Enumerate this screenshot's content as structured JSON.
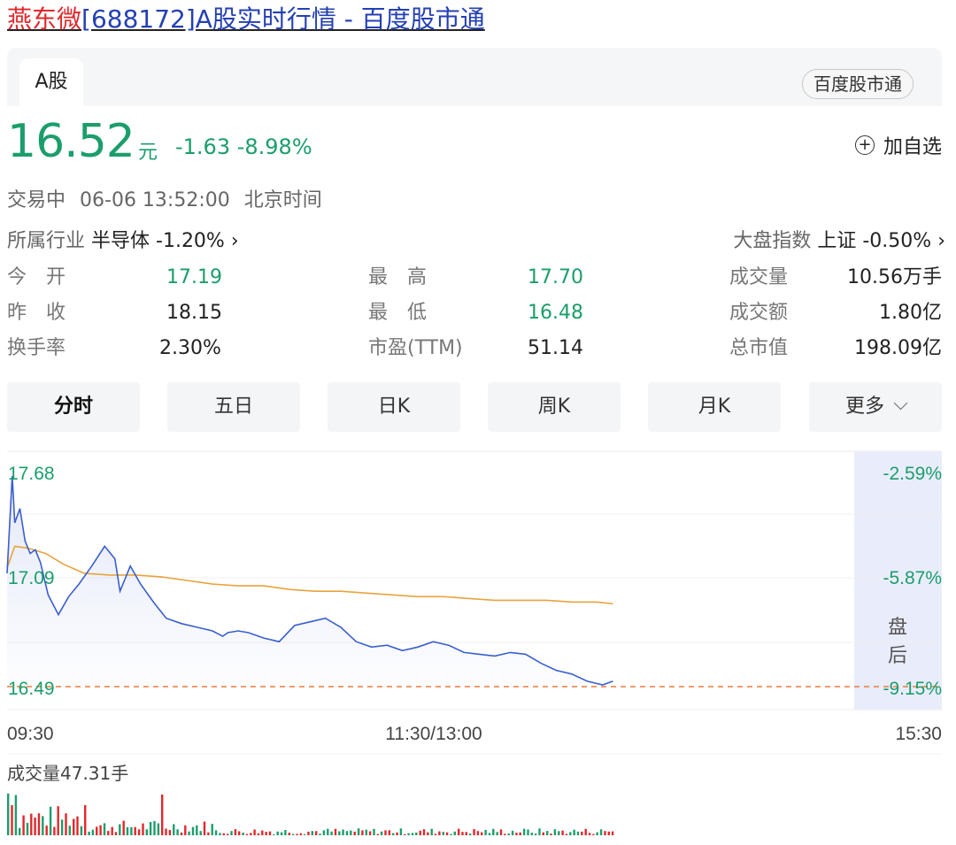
{
  "page": {
    "title_stock_name": "燕东微",
    "title_rest": "[688172]A股实时行情 - 百度股市通"
  },
  "tabs": {
    "active": "A股",
    "brand": "百度股市通"
  },
  "quote": {
    "price": "16.52",
    "unit": "元",
    "change": "-1.63 -8.98%",
    "add_watch": "加自选",
    "status": "交易中",
    "time": "06-06 13:52:00",
    "timezone": "北京时间",
    "industry_label": "所属行业",
    "industry_value": "半导体 -1.20% ›",
    "index_label": "大盘指数",
    "index_value": "上证 -0.50% ›",
    "color_down": "#1b9e6b",
    "color_up": "#e0282c"
  },
  "stats": [
    {
      "label": "今　开",
      "value": "17.19",
      "tone": "green"
    },
    {
      "label": "最　高",
      "value": "17.70",
      "tone": "green"
    },
    {
      "label": "成交量",
      "value": "10.56万手",
      "tone": "dark"
    },
    {
      "label": "昨　收",
      "value": "18.15",
      "tone": "dark"
    },
    {
      "label": "最　低",
      "value": "16.48",
      "tone": "green"
    },
    {
      "label": "成交额",
      "value": "1.80亿",
      "tone": "dark"
    },
    {
      "label": "换手率",
      "value": "2.30%",
      "tone": "dark"
    },
    {
      "label": "市盈(TTM)",
      "value": "51.14",
      "tone": "dark"
    },
    {
      "label": "总市值",
      "value": "198.09亿",
      "tone": "dark"
    }
  ],
  "periods": [
    "分时",
    "五日",
    "日K",
    "周K",
    "月K",
    "更多"
  ],
  "chart_data": {
    "type": "line",
    "y_ticks_left": [
      "17.68",
      "17.09",
      "16.49"
    ],
    "y_ticks_right": [
      "-2.59%",
      "-5.87%",
      "-9.15%"
    ],
    "x_ticks": [
      "09:30",
      "11:30/13:00",
      "15:30"
    ],
    "after_hours_label": [
      "盘",
      "后"
    ],
    "ylim": [
      16.49,
      17.68
    ],
    "reference_line": 16.49,
    "series": [
      {
        "color": "#3a5fcd",
        "x_minutes": [
          0,
          2,
          3,
          5,
          7,
          9,
          11,
          13,
          16,
          20,
          24,
          28,
          33,
          38,
          42,
          44,
          48,
          52,
          57,
          62,
          68,
          74,
          80,
          84,
          86,
          90,
          94,
          100,
          106,
          112,
          118,
          124,
          130,
          136,
          142,
          148,
          154,
          160,
          166,
          172,
          178,
          184,
          190,
          196,
          202,
          208,
          214,
          220,
          226,
          232,
          236
        ],
        "values": [
          17.12,
          17.66,
          17.4,
          17.48,
          17.3,
          17.23,
          17.25,
          17.18,
          17.0,
          16.89,
          16.99,
          17.06,
          17.16,
          17.27,
          17.2,
          17.02,
          17.16,
          17.06,
          16.96,
          16.87,
          16.84,
          16.82,
          16.8,
          16.77,
          16.79,
          16.8,
          16.79,
          16.76,
          16.74,
          16.83,
          16.85,
          16.87,
          16.82,
          16.74,
          16.71,
          16.72,
          16.69,
          16.71,
          16.74,
          16.72,
          16.68,
          16.67,
          16.66,
          16.68,
          16.67,
          16.62,
          16.58,
          16.56,
          16.52,
          16.5,
          16.52
        ]
      },
      {
        "color": "#e8a33d",
        "x_minutes": [
          0,
          3,
          8,
          15,
          22,
          30,
          40,
          50,
          60,
          70,
          80,
          90,
          100,
          110,
          120,
          130,
          140,
          150,
          160,
          170,
          180,
          190,
          200,
          210,
          220,
          230,
          236
        ],
        "values": [
          17.15,
          17.27,
          17.26,
          17.23,
          17.17,
          17.12,
          17.11,
          17.11,
          17.1,
          17.08,
          17.06,
          17.05,
          17.05,
          17.03,
          17.02,
          17.02,
          17.01,
          17.0,
          16.99,
          16.99,
          16.98,
          16.97,
          16.97,
          16.97,
          16.96,
          16.96,
          16.95
        ]
      }
    ],
    "volume_label": "成交量47.31手"
  }
}
